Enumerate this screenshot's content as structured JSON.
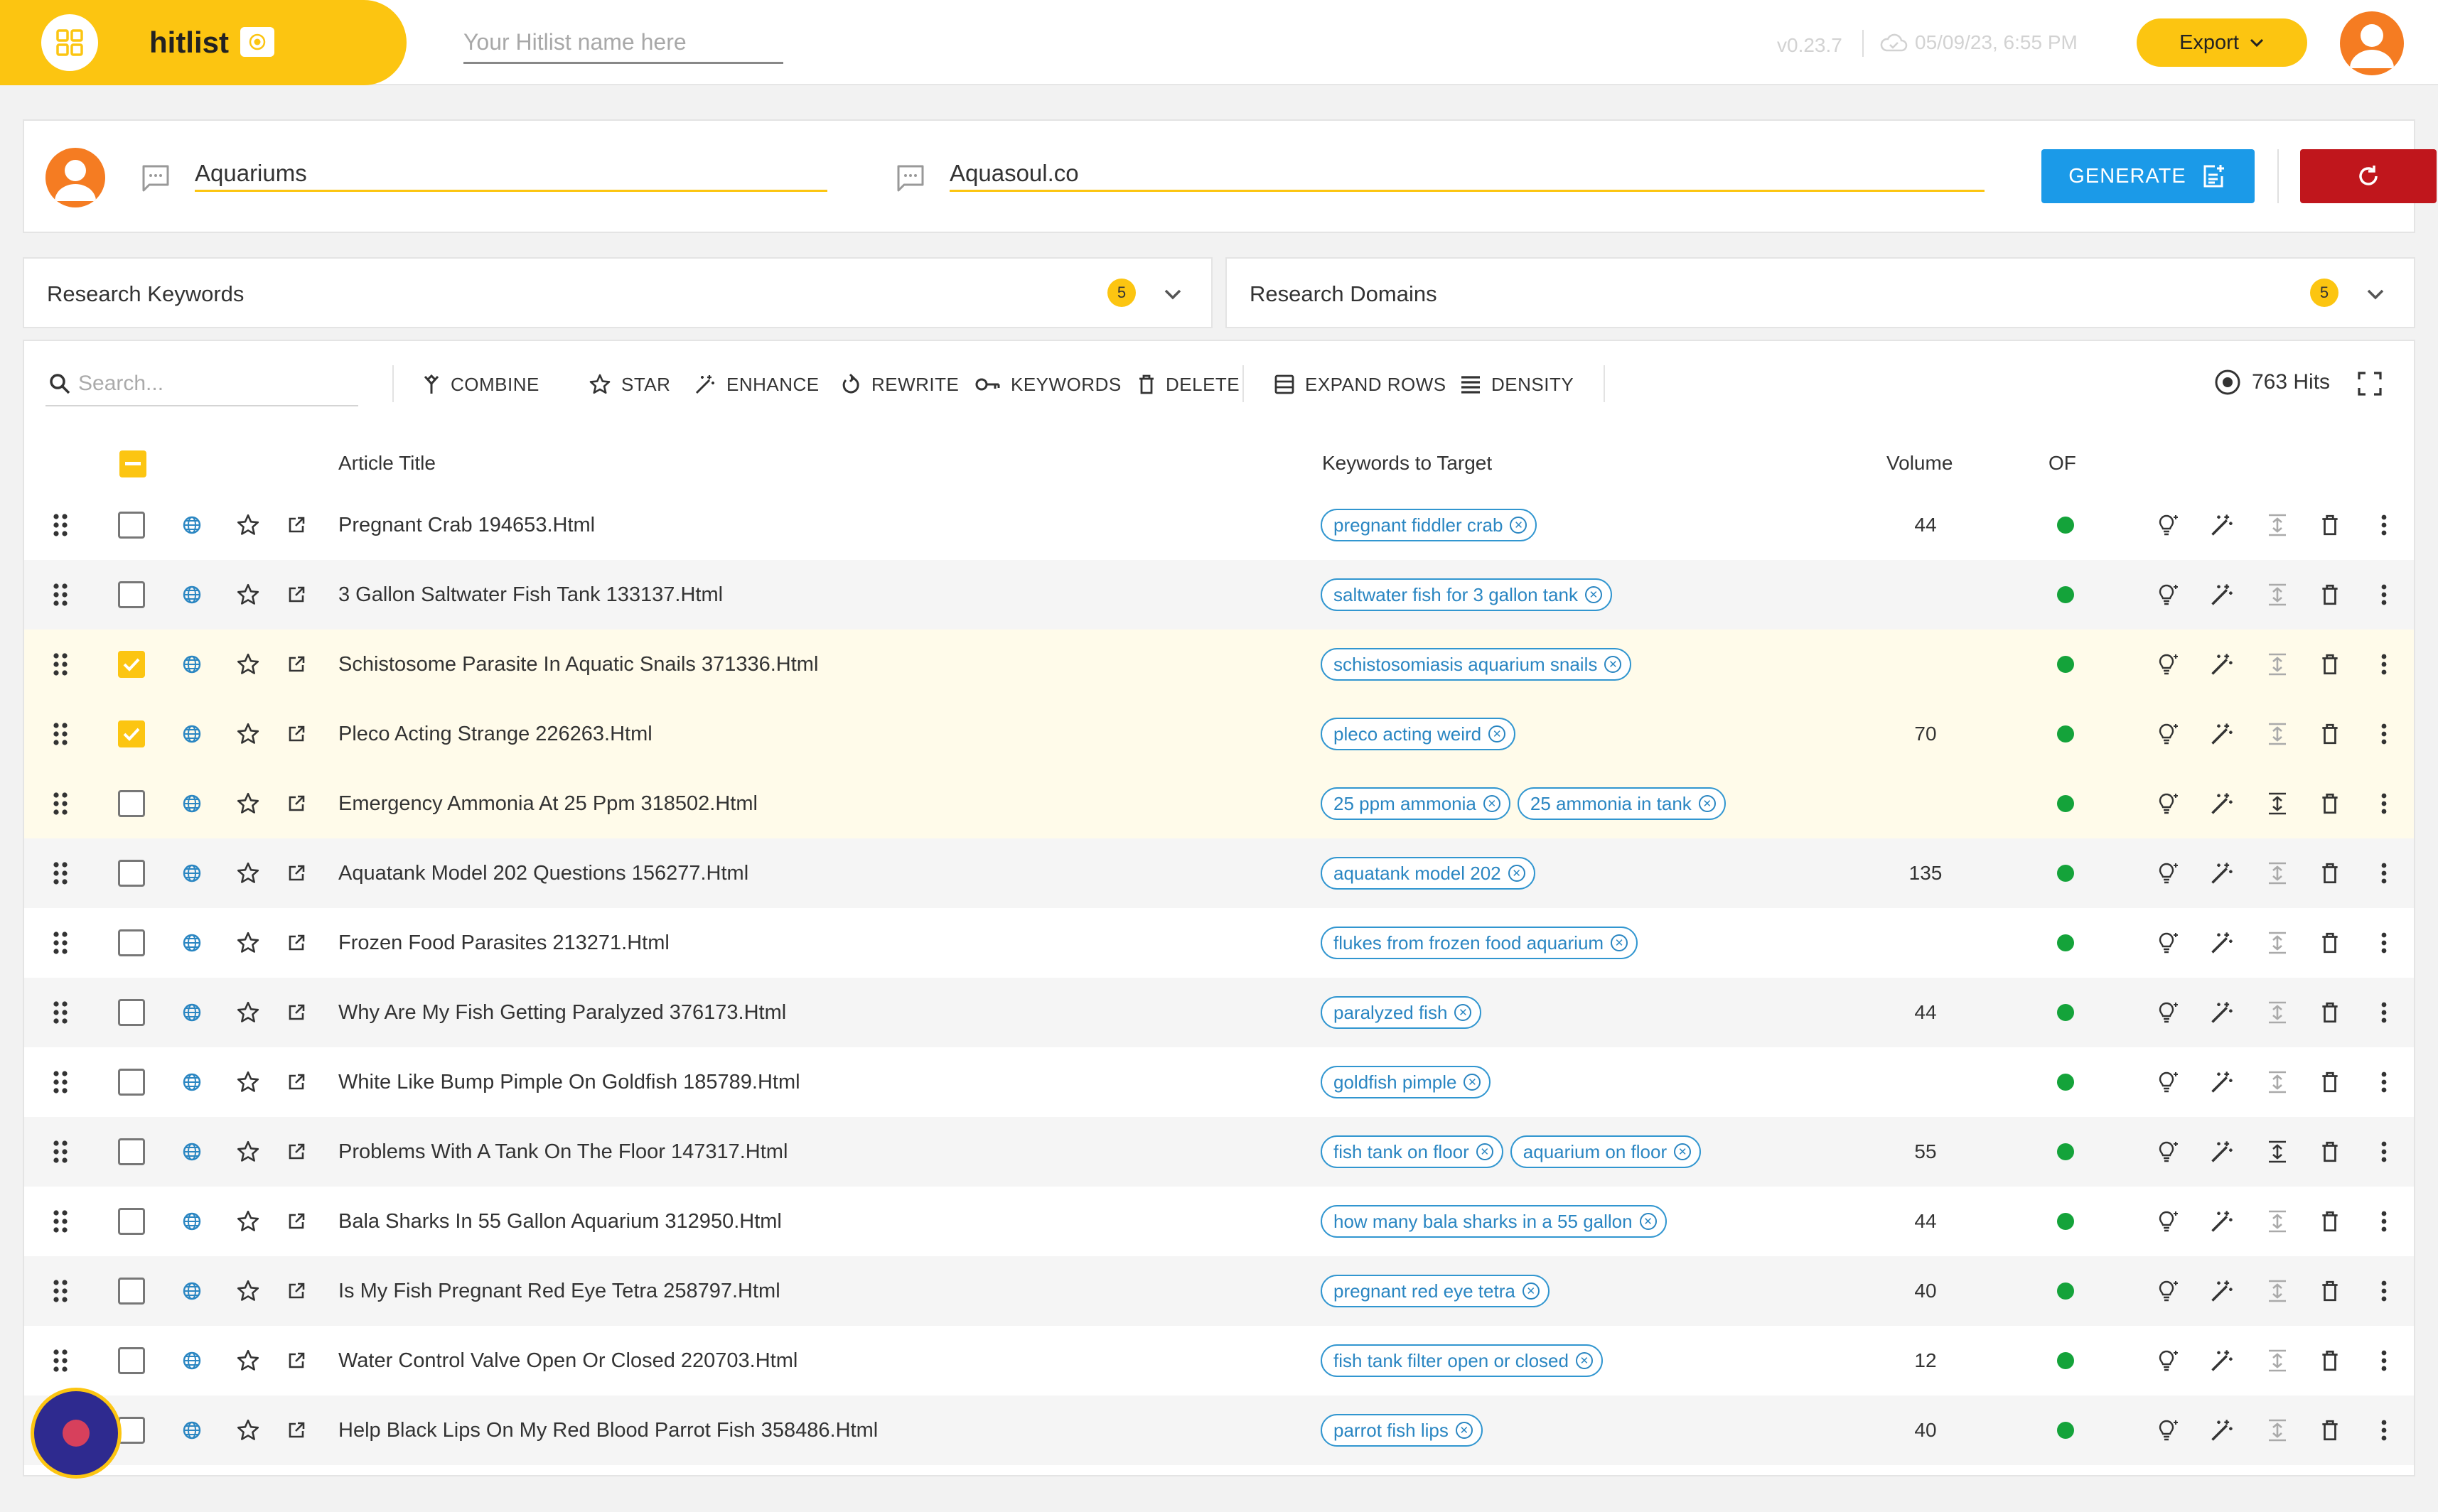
{
  "app": {
    "name": "hitlist",
    "hitlist_name_placeholder": "Your Hitlist name here",
    "version": "v0.23.7",
    "saved_time": "05/09/23, 6:55 PM",
    "export_label": "Export",
    "accent_color": "#fcc511"
  },
  "project": {
    "topic": "Aquariums",
    "domain": "Aquasoul.co",
    "generate_label": "GENERATE"
  },
  "research": {
    "keywords": {
      "title": "Research Keywords",
      "count": "5"
    },
    "domains": {
      "title": "Research Domains",
      "count": "5"
    }
  },
  "toolbar": {
    "search_placeholder": "Search...",
    "combine": "COMBINE",
    "star": "STAR",
    "enhance": "ENHANCE",
    "rewrite": "REWRITE",
    "keywords": "KEYWORDS",
    "delete": "DELETE",
    "expand_rows": "EXPAND ROWS",
    "density": "DENSITY",
    "hits": "763 Hits"
  },
  "table": {
    "headers": {
      "article_title": "Article Title",
      "keywords": "Keywords to Target",
      "volume": "Volume",
      "of": "OF"
    },
    "rows": [
      {
        "title": "Pregnant Crab 194653.Html",
        "keywords": [
          "pregnant fiddler crab"
        ],
        "volume": "44",
        "checked": false
      },
      {
        "title": "3 Gallon Saltwater Fish Tank 133137.Html",
        "keywords": [
          "saltwater fish for 3 gallon tank"
        ],
        "volume": "",
        "checked": false
      },
      {
        "title": "Schistosome Parasite In Aquatic Snails 371336.Html",
        "keywords": [
          "schistosomiasis aquarium snails"
        ],
        "volume": "",
        "checked": true
      },
      {
        "title": "Pleco Acting Strange 226263.Html",
        "keywords": [
          "pleco acting weird"
        ],
        "volume": "70",
        "checked": true
      },
      {
        "title": "Emergency Ammonia At 25 Ppm 318502.Html",
        "keywords": [
          "25 ppm ammonia",
          "25 ammonia in tank"
        ],
        "volume": "",
        "checked": false
      },
      {
        "title": "Aquatank Model 202 Questions 156277.Html",
        "keywords": [
          "aquatank model 202"
        ],
        "volume": "135",
        "checked": false
      },
      {
        "title": "Frozen Food Parasites 213271.Html",
        "keywords": [
          "flukes from frozen food aquarium"
        ],
        "volume": "",
        "checked": false
      },
      {
        "title": "Why Are My Fish Getting Paralyzed 376173.Html",
        "keywords": [
          "paralyzed fish"
        ],
        "volume": "44",
        "checked": false
      },
      {
        "title": "White Like Bump Pimple On Goldfish 185789.Html",
        "keywords": [
          "goldfish pimple"
        ],
        "volume": "",
        "checked": false
      },
      {
        "title": "Problems With A Tank On The Floor 147317.Html",
        "keywords": [
          "fish tank on floor",
          "aquarium on floor"
        ],
        "volume": "55",
        "checked": false
      },
      {
        "title": "Bala Sharks In 55 Gallon Aquarium 312950.Html",
        "keywords": [
          "how many bala sharks in a 55 gallon"
        ],
        "volume": "44",
        "checked": false
      },
      {
        "title": "Is My Fish Pregnant Red Eye Tetra 258797.Html",
        "keywords": [
          "pregnant red eye tetra"
        ],
        "volume": "40",
        "checked": false
      },
      {
        "title": "Water Control Valve Open Or Closed 220703.Html",
        "keywords": [
          "fish tank filter open or closed"
        ],
        "volume": "12",
        "checked": false
      },
      {
        "title": "Help Black Lips On My Red Blood Parrot Fish 358486.Html",
        "keywords": [
          "parrot fish lips"
        ],
        "volume": "40",
        "checked": false
      }
    ]
  }
}
